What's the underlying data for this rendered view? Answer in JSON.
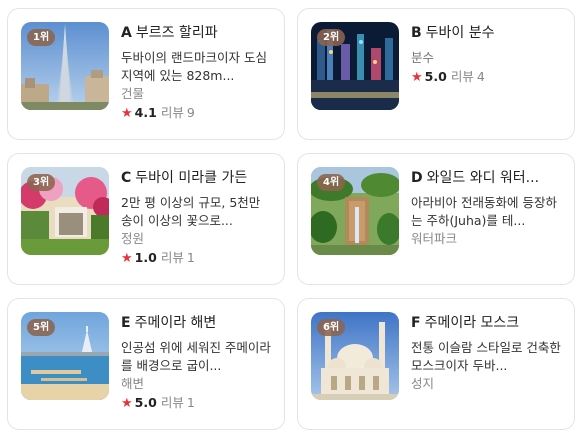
{
  "colors": {
    "star": "#e8333c",
    "rank_badge": "#8c6450",
    "border": "#e4e4e4"
  },
  "icons": {
    "rating": "star-icon"
  },
  "places": [
    {
      "rank": "1위",
      "letter": "A",
      "name": "부르즈 할리파",
      "description": "두바이의 랜드마크이자 도심지역에 있는 828m...",
      "category": "건물",
      "score": "4.1",
      "review_label": "리뷰",
      "review_count": "9"
    },
    {
      "rank": "2위",
      "letter": "B",
      "name": "두바이 분수",
      "category_top": "분수",
      "score": "5.0",
      "review_label": "리뷰",
      "review_count": "4"
    },
    {
      "rank": "3위",
      "letter": "C",
      "name": "두바이 미라클 가든",
      "description": "2만 평 이상의 규모, 5천만 송이 이상의 꽃으로...",
      "category": "정원",
      "score": "1.0",
      "review_label": "리뷰",
      "review_count": "1"
    },
    {
      "rank": "4위",
      "letter": "D",
      "name": "와일드 와디 워터...",
      "description": "아라비아 전래동화에 등장하는 주하(Juha)를 테...",
      "category": "워터파크"
    },
    {
      "rank": "5위",
      "letter": "E",
      "name": "주메이라 해변",
      "description": "인공섬 위에 세워진 주메이라를 배경으로 굽이...",
      "category": "해변",
      "score": "5.0",
      "review_label": "리뷰",
      "review_count": "1"
    },
    {
      "rank": "6위",
      "letter": "F",
      "name": "주메이라 모스크",
      "description": "전통 이슬람 스타일로 건축한 모스크이자 두바...",
      "category": "성지"
    }
  ]
}
